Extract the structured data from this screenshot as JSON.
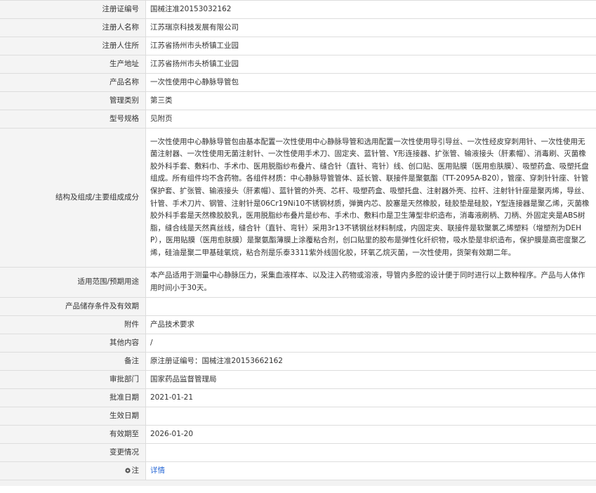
{
  "rows": [
    {
      "label": "注册证编号",
      "value": "国械注准20153032162"
    },
    {
      "label": "注册人名称",
      "value": "江苏瑞京科技发展有限公司"
    },
    {
      "label": "注册人住所",
      "value": "江苏省扬州市头桥镇工业园"
    },
    {
      "label": "生产地址",
      "value": "江苏省扬州市头桥镇工业园"
    },
    {
      "label": "产品名称",
      "value": "一次性使用中心静脉导管包"
    },
    {
      "label": "管理类别",
      "value": "第三类"
    },
    {
      "label": "型号规格",
      "value": "见附页"
    },
    {
      "label": "结构及组成/主要组成成分",
      "value": "一次性使用中心静脉导管包由基本配置一次性使用中心静脉导管和选用配置一次性使用导引导丝、一次性经皮穿刺用针、一次性使用无菌注射器、一次性使用无菌注射针、一次性使用手术刀、固定夹、蓝针管、Y形连接器、扩张管、输液接头（肝素帽）、消毒刷、灭菌橡胶外科手套、敷料巾、手术巾、医用脱脂纱布叠片、缝合针（直针、弯针）线、创口贴、医用贴膜（医用愈肤膜）、吸塑药盒、吸塑托盘组成。所有组件均不含药物。各组件材质：中心静脉导管管体、延长管、联接件是聚氨酯（TT-2095A-B20），管座、穿刺针针座、针管保护套、扩张管、输液接头（肝素帽）、蓝针管的外壳、芯杆、吸塑药盒、吸塑托盘、注射器外壳、拉杆、注射针针座是聚丙烯，导丝、针管、手术刀片、钢管、注射针是06Cr19Ni10不锈钢材质，弹簧内芯、胶塞是天然橡胶，硅胶垫是硅胶，Y型连接器是聚乙烯，灭菌橡胶外科手套是天然橡胶胶乳，医用脱脂纱布叠片是纱布、手术巾、敷料巾是卫生薄型非织造布，消毒液刷柄、刀柄、外固定夹是ABS树脂，缝合线是天然真丝线，缝合针（直针、弯针）采用3r13不锈钢丝材料制成，内固定夹、联接件是软聚氯乙烯塑料（增塑剂为DEHP），医用贴膜（医用愈肤膜）是聚氨酯薄膜上涂覆粘合剂，创口贴里的胶布是弹性化纤织物，吸水垫是非织造布，保护膜是高密度聚乙烯，硅油是聚二甲基硅氧烷，粘合剂是乐泰3311紫外线固化胶，环氧乙烷灭菌，一次性使用，货架有效期二年。"
    },
    {
      "label": "适用范围/预期用途",
      "value": "本产品适用于测量中心静脉压力，采集血液样本、以及注入药物或溶液，导管内多腔的设计便于同时进行以上数种程序。产品与人体作用时间小于30天。"
    },
    {
      "label": "产品储存条件及有效期",
      "value": ""
    },
    {
      "label": "附件",
      "value": "产品技术要求"
    },
    {
      "label": "其他内容",
      "value": "/"
    },
    {
      "label": "备注",
      "value": "原注册证编号：国械注准20153662162"
    },
    {
      "label": "审批部门",
      "value": "国家药品监督管理局"
    },
    {
      "label": "批准日期",
      "value": "2021-01-21"
    },
    {
      "label": "生效日期",
      "value": ""
    },
    {
      "label": "有效期至",
      "value": "2026-01-20"
    },
    {
      "label": "变更情况",
      "value": ""
    }
  ],
  "note_row": {
    "label": "注",
    "link": "详情",
    "icon": "info-pin-icon",
    "link_color": "#2c6bd6"
  },
  "colors": {
    "label_bg": "#f4f4f4",
    "border": "#dddddd",
    "text": "#333333"
  }
}
